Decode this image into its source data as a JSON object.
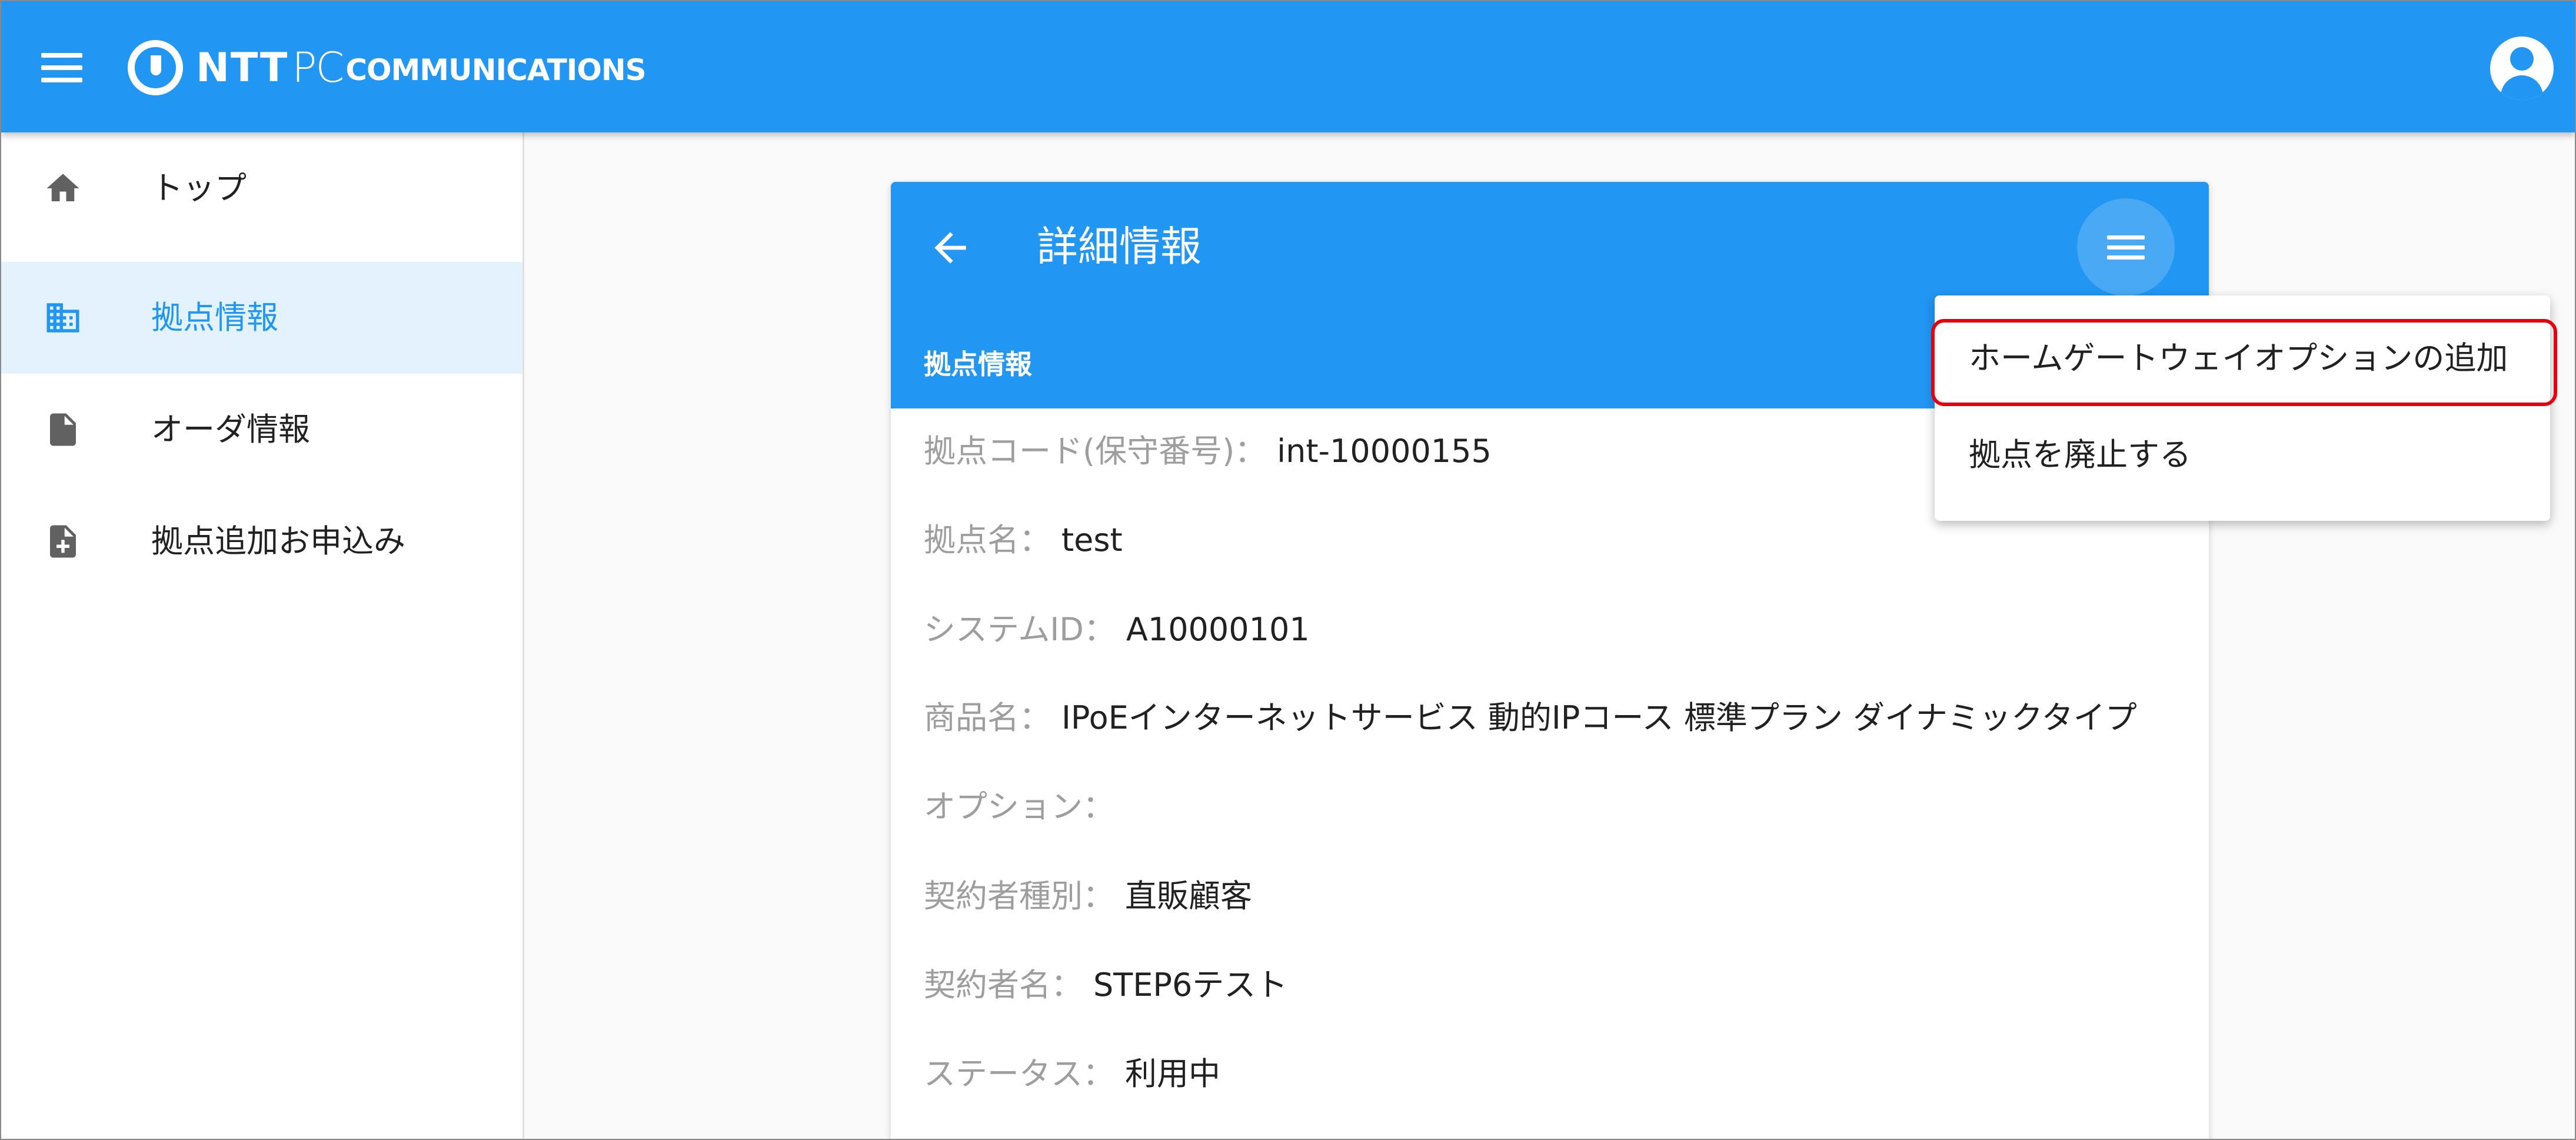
{
  "appbar": {
    "logo_ntt": "NTT",
    "logo_pc": "PC",
    "logo_comm": "COMMUNICATIONS",
    "menu_icon": "menu-icon",
    "account_icon": "account-circle-icon",
    "color": "#2196f3"
  },
  "sidebar": {
    "items": [
      {
        "label": "トップ",
        "icon": "home-icon",
        "active": false
      },
      {
        "label": "拠点情報",
        "icon": "building-icon",
        "active": true
      },
      {
        "label": "オーダ情報",
        "icon": "document-icon",
        "active": false
      },
      {
        "label": "拠点追加お申込み",
        "icon": "document-add-icon",
        "active": false
      }
    ]
  },
  "card": {
    "title": "詳細情報",
    "back_icon": "arrow-left-icon",
    "menu_icon": "menu-icon",
    "section_title": "拠点情報",
    "details": [
      {
        "label": "拠点コード(保守番号)：",
        "value": "int-10000155"
      },
      {
        "label": "拠点名：",
        "value": "test"
      },
      {
        "label": "システムID：",
        "value": "A10000101"
      },
      {
        "label": "商品名：",
        "value": "IPoEインターネットサービス 動的IPコース 標準プラン ダイナミックタイプ"
      },
      {
        "label": "オプション：",
        "value": ""
      },
      {
        "label": "契約者種別：",
        "value": "直販顧客"
      },
      {
        "label": "契約者名：",
        "value": "STEP6テスト"
      },
      {
        "label": "ステータス：",
        "value": "利用中"
      }
    ]
  },
  "dropdown": {
    "items": [
      {
        "label": "ホームゲートウェイオプションの追加",
        "highlighted": true
      },
      {
        "label": "拠点を廃止する",
        "highlighted": false
      }
    ],
    "highlight_color": "#e3000f"
  }
}
